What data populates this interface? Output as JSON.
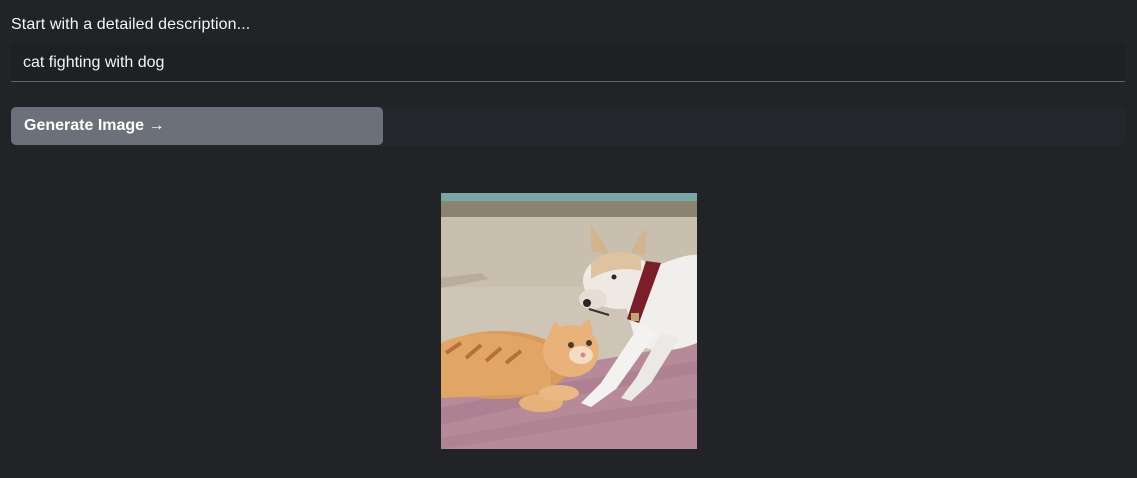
{
  "prompt": {
    "label": "Start with a detailed description...",
    "value": "cat fighting with dog"
  },
  "generate_button": {
    "label": "Generate Image →"
  },
  "result": {
    "image_subject": "orange tabby cat lying on a pink mat facing a white dog with a red collar"
  }
}
